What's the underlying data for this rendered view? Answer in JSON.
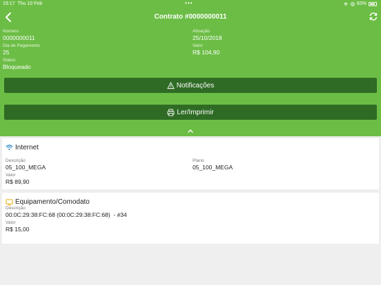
{
  "statusbar": {
    "time": "19:17",
    "date": "Thu 10 Feb",
    "dots": "•••",
    "battery": "83%"
  },
  "nav": {
    "title": "Contrato #0000000011",
    "back_icon": "chevron-left-icon",
    "refresh_icon": "refresh-icon"
  },
  "contract": {
    "numero_label": "Número",
    "numero": "0000000011",
    "ativacao_label": "Ativação",
    "ativacao": "25/10/2018",
    "dia_label": "Dia de Pagamento",
    "dia": "25",
    "valor_label": "Valor",
    "valor": "R$ 104,90",
    "status_label": "Status",
    "status": "Bloqueado"
  },
  "buttons": {
    "notificacoes": "Notificações",
    "imprimir": "Ler/Imprimir"
  },
  "internet": {
    "title": "Internet",
    "descricao_label": "Descrição",
    "descricao": "05_100_MEGA",
    "plano_label": "Plano",
    "plano": "05_100_MEGA",
    "valor_label": "Valor",
    "valor": "R$ 89,90"
  },
  "equipamento": {
    "title": "Equipamento/Comodato",
    "descricao_label": "Descrição",
    "descricao": "00:0C:29:38:FC:68 (00:0C:29:38:FC:68)  - #34",
    "valor_label": "Valor",
    "valor": "R$ 15,00"
  },
  "colors": {
    "header_green": "#6cbd45",
    "button_green": "#2f6b25",
    "wifi_blue": "#1f7fc4",
    "monitor_yellow": "#e8b82a"
  }
}
